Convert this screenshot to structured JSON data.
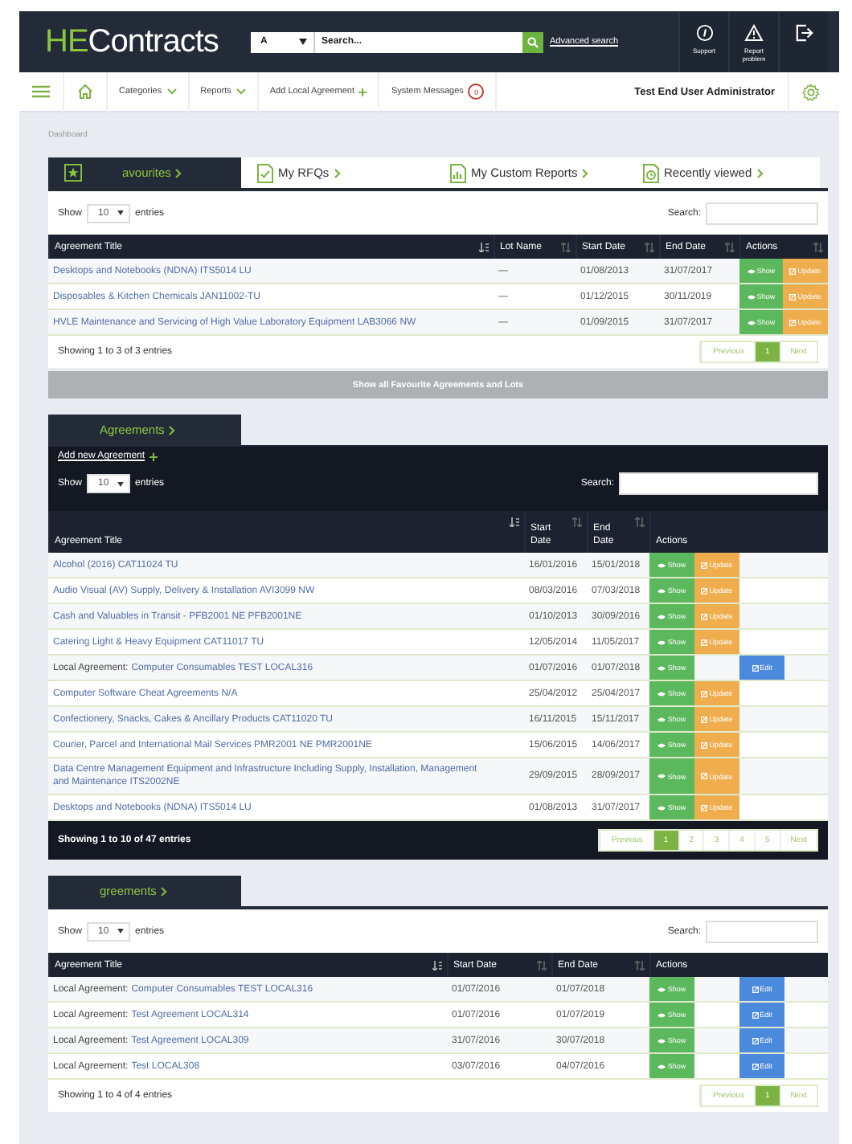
{
  "header": {
    "logo": {
      "accent": "HE",
      "rest": "Contracts"
    },
    "search": {
      "scope": "A",
      "placeholder": "Search..."
    },
    "advanced_search": "Advanced search",
    "tools": [
      {
        "kind": "support",
        "label": "Support"
      },
      {
        "kind": "report",
        "label": "Report problem"
      },
      {
        "kind": "logout"
      }
    ]
  },
  "nav": {
    "items": [
      {
        "kind": "menu"
      },
      {
        "kind": "home"
      },
      {
        "kind": "dropdown",
        "label": "Categories"
      },
      {
        "kind": "dropdown",
        "label": "Reports"
      },
      {
        "kind": "add",
        "label": "Add Local Agreement"
      },
      {
        "kind": "messages",
        "label": "System Messages",
        "badge": "0"
      }
    ],
    "user": "Test End User Administrator"
  },
  "breadcrumb": "Dashboard",
  "sections": [
    {
      "tabs": [
        {
          "kind": "favourites",
          "label": "avourites",
          "selected": true
        },
        {
          "kind": "rfqs",
          "label": "My RFQs",
          "selected": false
        },
        {
          "kind": "reports",
          "label": "My Custom Reports",
          "selected": false
        },
        {
          "kind": "recent",
          "label": "Recently viewed",
          "selected": false
        }
      ],
      "table": {
        "show_label": "Show",
        "length": "10",
        "entries_label": "entries",
        "search_label": "Search:",
        "columns": [
          {
            "label": "Agreement Title",
            "sorted": true
          },
          {
            "label": "Lot Name",
            "sorted": false,
            "sortable": true
          },
          {
            "label": "Start Date",
            "sorted": false,
            "sortable": true
          },
          {
            "label": "End Date",
            "sorted": false,
            "sortable": true
          },
          {
            "label": "Actions",
            "sorted": false,
            "sortable": true
          }
        ],
        "rows": [
          {
            "cells": [
              "Desktops and Notebooks (NDNA) ITS5014 LU",
              "—",
              "01/08/2013",
              "31/07/2017"
            ],
            "actions": [
              {
                "kind": "show",
                "label": "Show"
              },
              {
                "kind": "update",
                "label": "Update"
              }
            ]
          },
          {
            "cells": [
              "Disposables & Kitchen Chemicals JAN11002-TU",
              "—",
              "01/12/2015",
              "30/11/2019"
            ],
            "actions": [
              {
                "kind": "show",
                "label": "Show"
              },
              {
                "kind": "update",
                "label": "Update"
              }
            ]
          },
          {
            "cells": [
              "HVLE Maintenance and Servicing of High Value Laboratory Equipment LAB3066 NW",
              "—",
              "01/09/2015",
              "31/07/2017"
            ],
            "actions": [
              {
                "kind": "show",
                "label": "Show"
              },
              {
                "kind": "update",
                "label": "Update"
              }
            ]
          }
        ],
        "info": "Showing 1 to 3 of 3 entries",
        "pages": [
          {
            "label": "Previous",
            "selected": false
          },
          {
            "label": "1",
            "selected": true
          },
          {
            "label": "Next",
            "selected": false
          }
        ]
      },
      "bottom_button": "Show all Favourite Agreements and Lots"
    },
    {
      "tabs": [
        {
          "kind": "plain",
          "label": "Agreements",
          "selected": true
        }
      ],
      "add_link": "Add new Agreement",
      "table": {
        "show_label": "Show",
        "length": "10",
        "entries_label": "entries",
        "search_label": "Search:",
        "columns": [
          {
            "label": "Agreement Title",
            "sorted": true
          },
          {
            "label": "Start Date",
            "sorted": false,
            "sortable": true
          },
          {
            "label": "End Date",
            "sorted": false,
            "sortable": true
          },
          {
            "label": "Actions",
            "sorted": false,
            "sortable": false
          }
        ],
        "rows": [
          {
            "cells": [
              "Alcohol (2016) CAT11024 TU",
              "16/01/2016",
              "15/01/2018"
            ],
            "actions": [
              {
                "kind": "show",
                "label": "Show"
              },
              {
                "kind": "update",
                "label": "Update"
              }
            ]
          },
          {
            "cells": [
              "Audio Visual (AV) Supply, Delivery & Installation AVI3099 NW",
              "08/03/2016",
              "07/03/2018"
            ],
            "actions": [
              {
                "kind": "show",
                "label": "Show"
              },
              {
                "kind": "update",
                "label": "Update"
              }
            ]
          },
          {
            "cells": [
              "Cash and Valuables in Transit - PFB2001 NE PFB2001NE",
              "01/10/2013",
              "30/09/2016"
            ],
            "actions": [
              {
                "kind": "show",
                "label": "Show"
              },
              {
                "kind": "update",
                "label": "Update"
              }
            ]
          },
          {
            "cells": [
              "Catering Light & Heavy Equipment CAT11017 TU",
              "12/05/2014",
              "11/05/2017"
            ],
            "actions": [
              {
                "kind": "show",
                "label": "Show"
              },
              {
                "kind": "update",
                "label": "Update"
              }
            ]
          },
          {
            "prefix": "Local Agreement:",
            "cells": [
              "Computer Consumables TEST LOCAL316",
              "01/07/2016",
              "01/07/2018"
            ],
            "actions": [
              {
                "kind": "show",
                "label": "Show"
              },
              {
                "kind": "edit",
                "label": "Edit"
              }
            ]
          },
          {
            "cells": [
              "Computer Software Cheat Agreements N/A",
              "25/04/2012",
              "25/04/2017"
            ],
            "actions": [
              {
                "kind": "show",
                "label": "Show"
              },
              {
                "kind": "update",
                "label": "Update"
              }
            ]
          },
          {
            "cells": [
              "Confectionery, Snacks, Cakes & Ancillary Products CAT11020 TU",
              "16/11/2015",
              "15/11/2017"
            ],
            "actions": [
              {
                "kind": "show",
                "label": "Show"
              },
              {
                "kind": "update",
                "label": "Update"
              }
            ]
          },
          {
            "cells": [
              "Courier, Parcel and International Mail Services PMR2001 NE PMR2001NE",
              "15/06/2015",
              "14/06/2017"
            ],
            "actions": [
              {
                "kind": "show",
                "label": "Show"
              },
              {
                "kind": "update",
                "label": "Update"
              }
            ]
          },
          {
            "cells": [
              "Data Centre Management Equipment and Infrastructure Including Supply, Installation, Management and Maintenance ITS2002NE",
              "29/09/2015",
              "28/09/2017"
            ],
            "actions": [
              {
                "kind": "show",
                "label": "Show"
              },
              {
                "kind": "update",
                "label": "Update"
              }
            ]
          },
          {
            "cells": [
              "Desktops and Notebooks (NDNA) ITS5014 LU",
              "01/08/2013",
              "31/07/2017"
            ],
            "actions": [
              {
                "kind": "show",
                "label": "Show"
              },
              {
                "kind": "update",
                "label": "Update"
              }
            ]
          }
        ],
        "info": "Showing 1 to 10 of 47 entries",
        "pages": [
          {
            "label": "Previous",
            "selected": false
          },
          {
            "label": "1",
            "selected": true
          },
          {
            "label": "2",
            "selected": false
          },
          {
            "label": "3",
            "selected": false
          },
          {
            "label": "4",
            "selected": false
          },
          {
            "label": "5",
            "selected": false
          },
          {
            "label": "Next",
            "selected": false
          }
        ]
      }
    },
    {
      "tabs": [
        {
          "kind": "plain",
          "label": "greements",
          "selected": true
        }
      ],
      "table": {
        "show_label": "Show",
        "length": "10",
        "entries_label": "entries",
        "search_label": "Search:",
        "columns": [
          {
            "label": "Agreement Title",
            "sorted": true
          },
          {
            "label": "Start Date",
            "sorted": false,
            "sortable": true
          },
          {
            "label": "End Date",
            "sorted": false,
            "sortable": true
          },
          {
            "label": "Actions",
            "sorted": false,
            "sortable": false
          }
        ],
        "rows": [
          {
            "prefix": "Local Agreement:",
            "cells": [
              "Computer Consumables TEST LOCAL316",
              "01/07/2016",
              "01/07/2018"
            ],
            "actions": [
              {
                "kind": "show",
                "label": "Show"
              },
              {
                "kind": "edit",
                "label": "Edit"
              }
            ]
          },
          {
            "prefix": "Local Agreement:",
            "cells": [
              "Test Agreement LOCAL314",
              "01/07/2016",
              "01/07/2019"
            ],
            "actions": [
              {
                "kind": "show",
                "label": "Show"
              },
              {
                "kind": "edit",
                "label": "Edit"
              }
            ]
          },
          {
            "prefix": "Local Agreement:",
            "cells": [
              "Test Agreement LOCAL309",
              "31/07/2016",
              "30/07/2018"
            ],
            "actions": [
              {
                "kind": "show",
                "label": "Show"
              },
              {
                "kind": "edit",
                "label": "Edit"
              }
            ]
          },
          {
            "prefix": "Local Agreement:",
            "cells": [
              "Test LOCAL308",
              "03/07/2016",
              "04/07/2016"
            ],
            "actions": [
              {
                "kind": "show",
                "label": "Show"
              },
              {
                "kind": "edit",
                "label": "Edit"
              }
            ]
          }
        ],
        "info": "Showing 1 to 4 of 4 entries",
        "pages": [
          {
            "label": "Previous",
            "selected": false
          },
          {
            "label": "1",
            "selected": true
          },
          {
            "label": "Next",
            "selected": false
          }
        ]
      }
    }
  ]
}
